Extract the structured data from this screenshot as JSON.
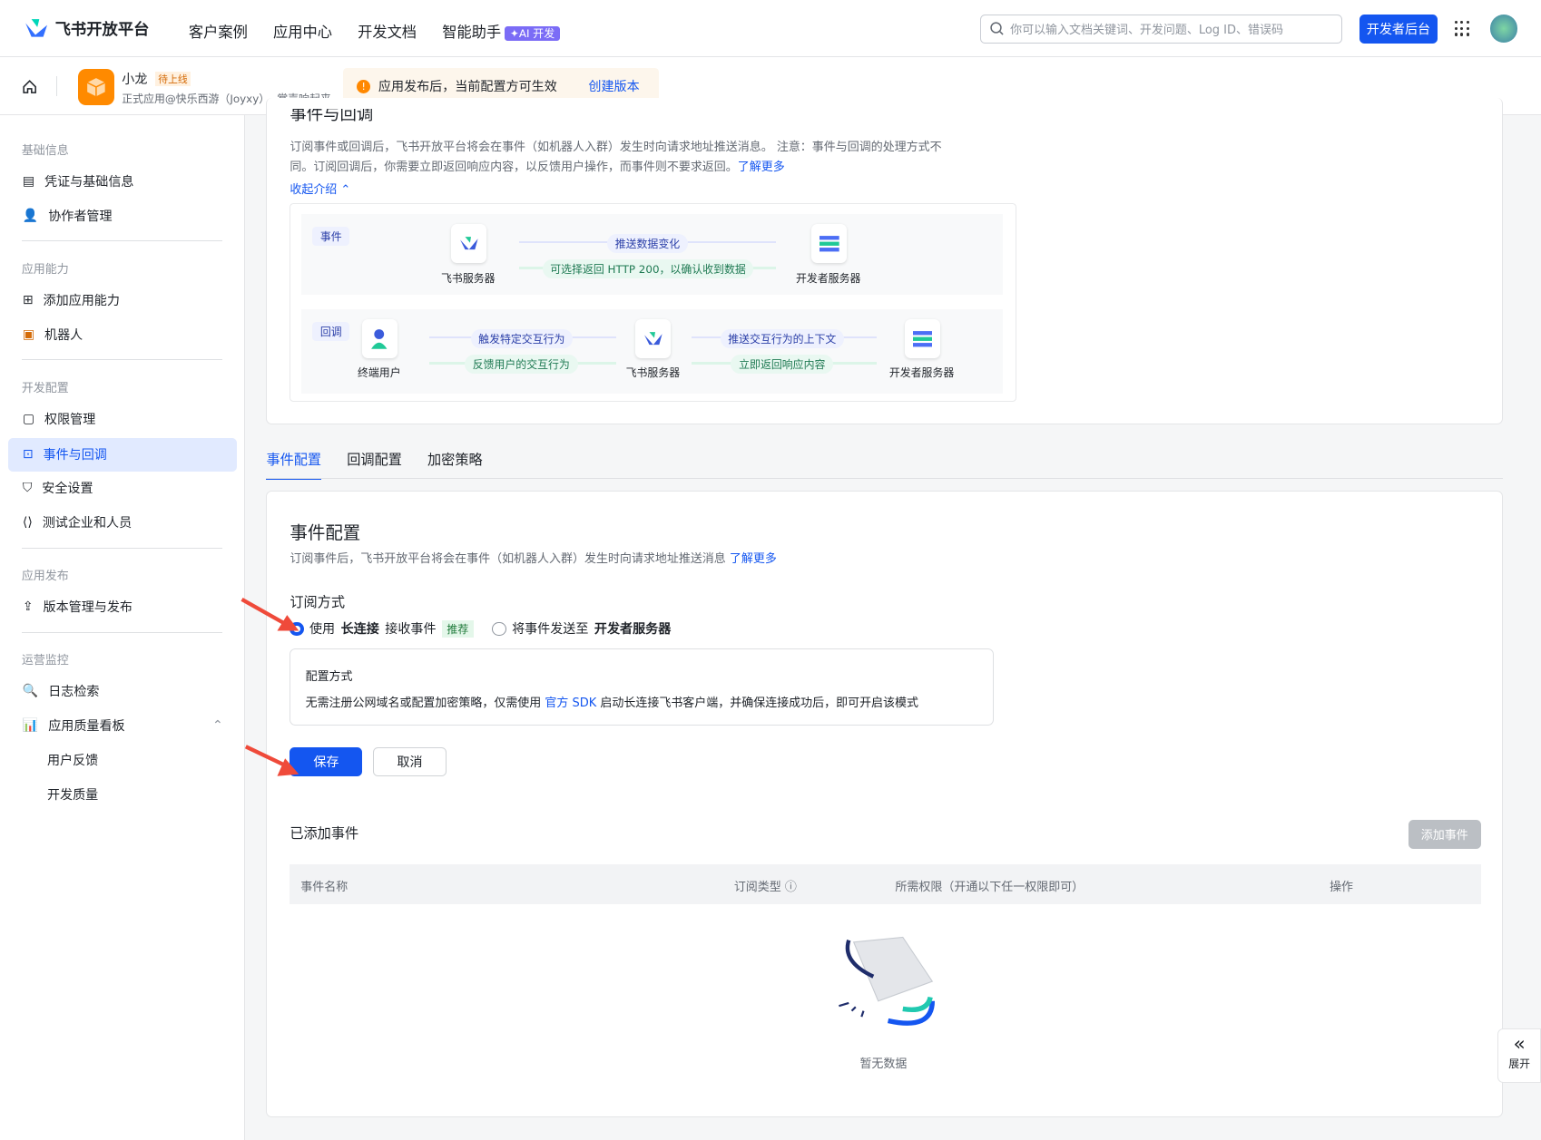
{
  "header": {
    "brand": "飞书开放平台",
    "nav": [
      "客户案例",
      "应用中心",
      "开发文档",
      "智能助手"
    ],
    "ai_badge": "✦AI 开发",
    "search_placeholder": "你可以输入文档关键词、开发问题、Log ID、错误码",
    "dev_console": "开发者后台"
  },
  "app": {
    "name": "小龙",
    "status": "待上线",
    "subtitle": "正式应用@快乐西游（Joyxy）- 掌声响起来",
    "notice": "应用发布后，当前配置方可生效",
    "create_version": "创建版本"
  },
  "sidebar": {
    "sections": [
      {
        "title": "基础信息",
        "items": [
          "凭证与基础信息",
          "协作者管理"
        ]
      },
      {
        "title": "应用能力",
        "items": [
          "添加应用能力",
          "机器人"
        ]
      },
      {
        "title": "开发配置",
        "items": [
          "权限管理",
          "事件与回调",
          "安全设置",
          "测试企业和人员"
        ]
      },
      {
        "title": "应用发布",
        "items": [
          "版本管理与发布"
        ]
      },
      {
        "title": "运营监控",
        "items": [
          "日志检索",
          "应用质量看板",
          "用户反馈",
          "开发质量"
        ]
      }
    ],
    "active": "事件与回调"
  },
  "intro": {
    "title": "事件与回调",
    "desc1": "订阅事件或回调后，飞书开放平台将会在事件（如机器人入群）发生时向请求地址推送消息。 注意：事件与回调的处理方式不",
    "desc2": "同。订阅回调后，你需要立即返回响应内容，以反馈用户操作，而事件则不要求返回。",
    "learn_more": "了解更多",
    "collapse": "收起介绍",
    "diagram": {
      "event_tag": "事件",
      "callback_tag": "回调",
      "feishu_server": "飞书服务器",
      "dev_server": "开发者服务器",
      "end_user": "终端用户",
      "push_change": "推送数据变化",
      "return_200": "可选择返回 HTTP 200，以确认收到数据",
      "trigger": "触发特定交互行为",
      "feedback": "反馈用户的交互行为",
      "push_context": "推送交互行为的上下文",
      "return_now": "立即返回响应内容"
    }
  },
  "tabs": [
    "事件配置",
    "回调配置",
    "加密策略"
  ],
  "active_tab": "事件配置",
  "event_config": {
    "title": "事件配置",
    "desc": "订阅事件后，飞书开放平台将会在事件（如机器人入群）发生时向请求地址推送消息",
    "learn_more": "了解更多",
    "sub_mode": "订阅方式",
    "opt1_a": "使用",
    "opt1_b": "长连接",
    "opt1_c": "接收事件",
    "recommend": "推荐",
    "opt2_a": "将事件发送至",
    "opt2_b": "开发者服务器",
    "box_title": "配置方式",
    "box_a": "无需注册公网域名或配置加密策略，仅需使用",
    "box_link": "官方 SDK",
    "box_b": "启动长连接飞书客户端，并确保连接成功后，即可开启该模式",
    "save": "保存",
    "cancel": "取消"
  },
  "added": {
    "title": "已添加事件",
    "add": "添加事件",
    "columns": [
      "事件名称",
      "订阅类型",
      "所需权限（开通以下任一权限即可）",
      "操作"
    ],
    "empty": "暂无数据"
  },
  "expand": "展开"
}
